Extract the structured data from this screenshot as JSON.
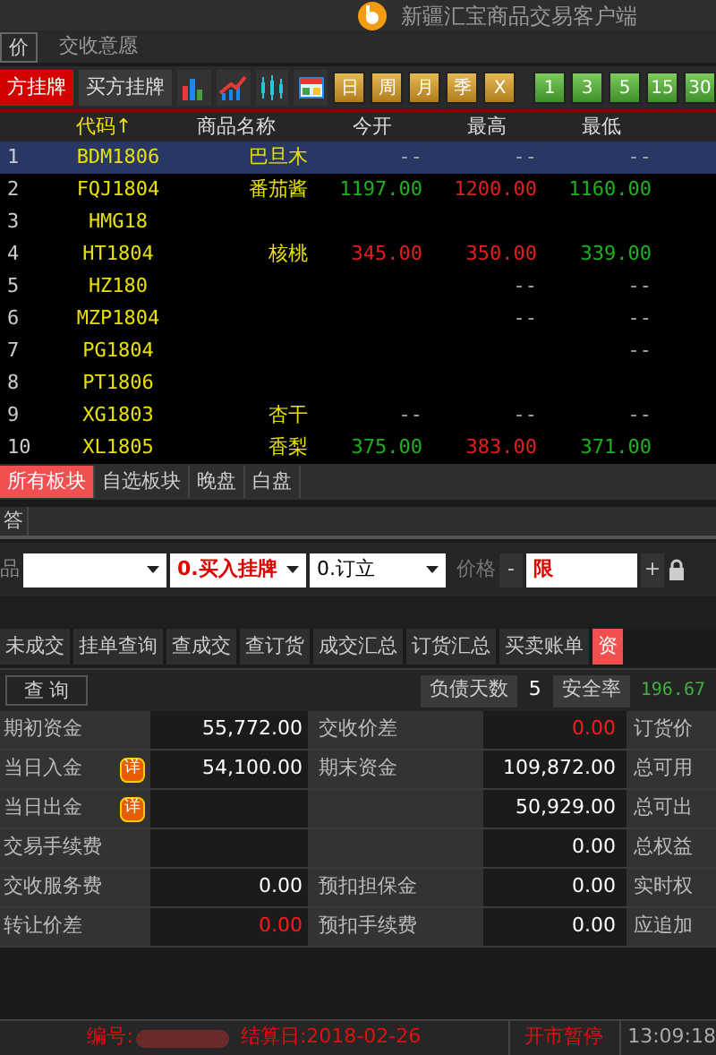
{
  "window": {
    "title": "新疆汇宝商品交易客户端"
  },
  "menu": [
    {
      "label": "价",
      "selected": true
    },
    {
      "label": "交收意愿",
      "selected": false
    }
  ],
  "toolbar": {
    "trade_buttons": [
      {
        "label": "方挂牌",
        "selected": true
      },
      {
        "label": "买方挂牌",
        "selected": false
      }
    ],
    "chart_icons": [
      {
        "kind": "bar"
      },
      {
        "kind": "trend"
      },
      {
        "kind": "candle"
      },
      {
        "kind": "grid"
      }
    ],
    "period_buttons": [
      "日",
      "周",
      "月",
      "季",
      "X"
    ],
    "minute_buttons": [
      "1",
      "3",
      "5",
      "15",
      "30"
    ]
  },
  "quote_table": {
    "columns": [
      "代码↑",
      "商品名称",
      "今开",
      "最高",
      "最低"
    ],
    "rows": [
      {
        "index": "1",
        "code": "BDM1806",
        "name": "巴旦木",
        "open": "--",
        "high": "--",
        "low": "--",
        "selected": true
      },
      {
        "index": "2",
        "code": "FQJ1804",
        "name": "番茄酱",
        "open": "1197.00",
        "high": "1200.00",
        "low": "1160.00",
        "selected": false
      },
      {
        "index": "3",
        "code": "HMG18",
        "selected": false
      },
      {
        "index": "4",
        "code": "HT1804",
        "name": "核桃",
        "open": "345.00",
        "high": "350.00",
        "low": "339.00",
        "selected": false
      },
      {
        "index": "5",
        "code": "HZ180",
        "high": "--",
        "low": "--",
        "selected": false
      },
      {
        "index": "6",
        "code": "MZP1804",
        "high": "--",
        "low": "--",
        "selected": false
      },
      {
        "index": "7",
        "code": "PG1804",
        "low": "--",
        "selected": false
      },
      {
        "index": "8",
        "code": "PT1806",
        "selected": false
      },
      {
        "index": "9",
        "code": "XG1803",
        "name": "杏干",
        "open": "--",
        "high": "--",
        "low": "--",
        "selected": false
      },
      {
        "index": "10",
        "code": "XL1805",
        "name": "香梨",
        "open": "375.00",
        "high": "383.00",
        "low": "371.00",
        "selected": false
      }
    ]
  },
  "board_tabs": [
    {
      "label": "所有板块",
      "selected": true
    },
    {
      "label": "自选板块",
      "selected": false
    },
    {
      "label": "晚盘",
      "selected": false
    },
    {
      "label": "白盘",
      "selected": false
    }
  ],
  "answer_tab": "答",
  "order_form": {
    "product_label": "品",
    "type_value": "0.买入挂牌",
    "open_value": "0.订立",
    "price_label": "价格",
    "minus": "-",
    "price_value": "限",
    "plus": "+"
  },
  "query_tabs": [
    {
      "label": "未成交",
      "selected": false
    },
    {
      "label": "挂单查询",
      "selected": false
    },
    {
      "label": "查成交",
      "selected": false
    },
    {
      "label": "查订货",
      "selected": false
    },
    {
      "label": "成交汇总",
      "selected": false
    },
    {
      "label": "订货汇总",
      "selected": false
    },
    {
      "label": "买卖账单",
      "selected": false
    },
    {
      "label": "资",
      "selected": true
    }
  ],
  "query_bar": {
    "button": "查 询",
    "debt_days_label": "负债天数",
    "debt_days": "5",
    "safety_label": "安全率",
    "safety_value": "196.67"
  },
  "funds": [
    {
      "label": "期初资金",
      "value": "55,772.00",
      "label2": "交收价差",
      "value2": "0.00",
      "value2_red": true,
      "label3": "订货价"
    },
    {
      "label": "当日入金",
      "detail": "详",
      "value": "54,100.00",
      "label2": "期末资金",
      "value2": "109,872.00",
      "label3": "总可用"
    },
    {
      "label": "当日出金",
      "detail": "详",
      "value2": "50,929.00",
      "label3": "总可出"
    },
    {
      "label": "交易手续费",
      "value2": "0.00",
      "label3": "总权益"
    },
    {
      "label": "交收服务费",
      "value": "0.00",
      "label2": "预扣担保金",
      "value2": "0.00",
      "label3": "实时权"
    },
    {
      "label": "转让价差",
      "value": "0.00",
      "value_red": true,
      "label2": "预扣手续费",
      "value2": "0.00",
      "label3": "应追加"
    }
  ],
  "status_bar": {
    "id_label": "编号:",
    "settle_date": "结算日:2018-02-26",
    "market_state": "开市暂停",
    "time": "13:09:18"
  }
}
